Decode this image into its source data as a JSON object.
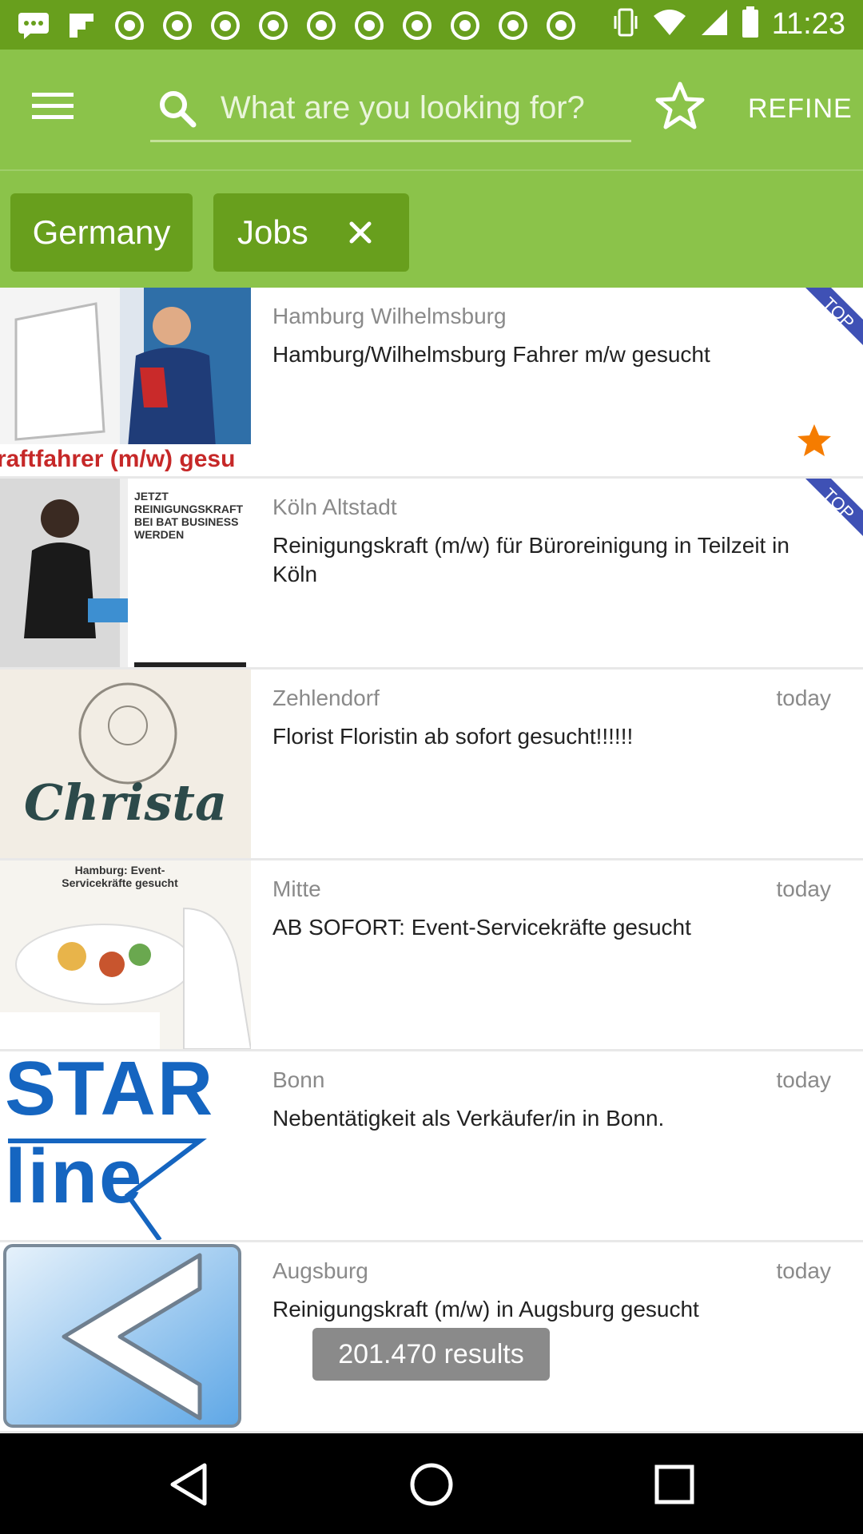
{
  "status_bar": {
    "time": "11:23",
    "left_icons": [
      "message-icon",
      "flipboard-icon",
      "notification-icon",
      "notification-icon",
      "notification-icon",
      "notification-icon",
      "notification-icon",
      "notification-icon",
      "notification-icon",
      "notification-icon",
      "notification-icon",
      "notification-icon"
    ],
    "right_icons": [
      "vibrate-icon",
      "wifi-icon",
      "signal-icon",
      "battery-icon"
    ]
  },
  "app_bar": {
    "menu_icon": "menu-icon",
    "search": {
      "placeholder": "What are you looking for?",
      "value": "",
      "icon": "search-icon"
    },
    "favorite_icon": "star-outline-icon",
    "refine_label": "REFINE",
    "background_color": "#8bc34a",
    "accent_dark": "#689f1d"
  },
  "filters": {
    "chips": [
      {
        "label": "Germany",
        "removable": false
      },
      {
        "label": "Jobs",
        "removable": true
      }
    ]
  },
  "listings": [
    {
      "location": "Hamburg Wilhelmsburg",
      "title": "Hamburg/Wilhelmsburg Fahrer m/w gesucht",
      "time": "",
      "top": true,
      "favorite": true,
      "thumb_text": "raftfahrer (m/w) gesu"
    },
    {
      "location": "Köln Altstadt",
      "title": "Reinigungskraft (m/w) für Büroreinigung in Teilzeit in Köln",
      "time": "",
      "top": true,
      "favorite": false,
      "thumb_text": "JETZT REINIGUNGSKRAFT BEI BAT BUSINESS WERDEN"
    },
    {
      "location": "Zehlendorf",
      "title": "Florist Floristin ab sofort gesucht!!!!!!",
      "time": "today",
      "top": false,
      "favorite": false,
      "thumb_text": "Christa"
    },
    {
      "location": "Mitte",
      "title": "AB SOFORT: Event-Servicekräfte gesucht",
      "time": "today",
      "top": false,
      "favorite": false,
      "thumb_text": "Hamburg: Event-Servicekräfte gesucht"
    },
    {
      "location": "Bonn",
      "title": "Nebentätigkeit als Verkäufer/in in Bonn.",
      "time": "today",
      "top": false,
      "favorite": false,
      "thumb_text": "STAR line"
    },
    {
      "location": "Augsburg",
      "title": "Reinigungskraft (m/w) in Augsburg gesucht",
      "time": "today",
      "top": false,
      "favorite": false,
      "thumb_text": ""
    }
  ],
  "top_badge_label": "TOP",
  "results_label": "201.470 results",
  "nav_bar": {
    "icons": [
      "back-icon",
      "home-icon",
      "recents-icon"
    ]
  }
}
